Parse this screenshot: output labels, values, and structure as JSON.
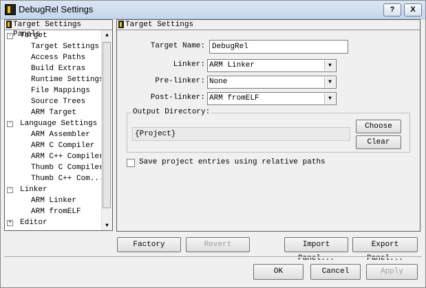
{
  "window": {
    "title": "DebugRel Settings",
    "help_label": "?",
    "close_label": "X"
  },
  "tree_panel": {
    "header": "Target Settings Panels",
    "items": [
      {
        "label": "Target",
        "level": 0,
        "expander": "-"
      },
      {
        "label": "Target Settings",
        "level": 1
      },
      {
        "label": "Access Paths",
        "level": 1
      },
      {
        "label": "Build Extras",
        "level": 1
      },
      {
        "label": "Runtime Settings",
        "level": 1
      },
      {
        "label": "File Mappings",
        "level": 1
      },
      {
        "label": "Source Trees",
        "level": 1
      },
      {
        "label": "ARM Target",
        "level": 1
      },
      {
        "label": "Language Settings",
        "level": 0,
        "expander": "-"
      },
      {
        "label": "ARM Assembler",
        "level": 1
      },
      {
        "label": "ARM C Compiler",
        "level": 1
      },
      {
        "label": "ARM C++ Compiler",
        "level": 1
      },
      {
        "label": "Thumb C Compiler",
        "level": 1
      },
      {
        "label": "Thumb C++ Com...",
        "level": 1
      },
      {
        "label": "Linker",
        "level": 0,
        "expander": "-"
      },
      {
        "label": "ARM Linker",
        "level": 1
      },
      {
        "label": "ARM fromELF",
        "level": 1
      },
      {
        "label": "Editor",
        "level": 0,
        "expander": "+"
      }
    ]
  },
  "settings_panel": {
    "header": "Target Settings",
    "target_name_label": "Target Name:",
    "target_name_value": "DebugRel",
    "linker_label": "Linker:",
    "linker_value": "ARM Linker",
    "prelinker_label": "Pre-linker:",
    "prelinker_value": "None",
    "postlinker_label": "Post-linker:",
    "postlinker_value": "ARM fromELF",
    "output_dir_label": "Output Directory:",
    "output_dir_value": "{Project}",
    "choose_label": "Choose",
    "clear_label": "Clear",
    "save_relative_label": "Save project entries using relative paths",
    "save_relative_checked": false
  },
  "panel_buttons": {
    "factory_settings": "Factory Settings",
    "revert": "Revert",
    "import_panel": "Import Panel...",
    "export_panel": "Export Panel..."
  },
  "dialog_buttons": {
    "ok": "OK",
    "cancel": "Cancel",
    "apply": "Apply"
  },
  "icons": {
    "arrow_down": "▼",
    "arrow_up": "▲"
  }
}
